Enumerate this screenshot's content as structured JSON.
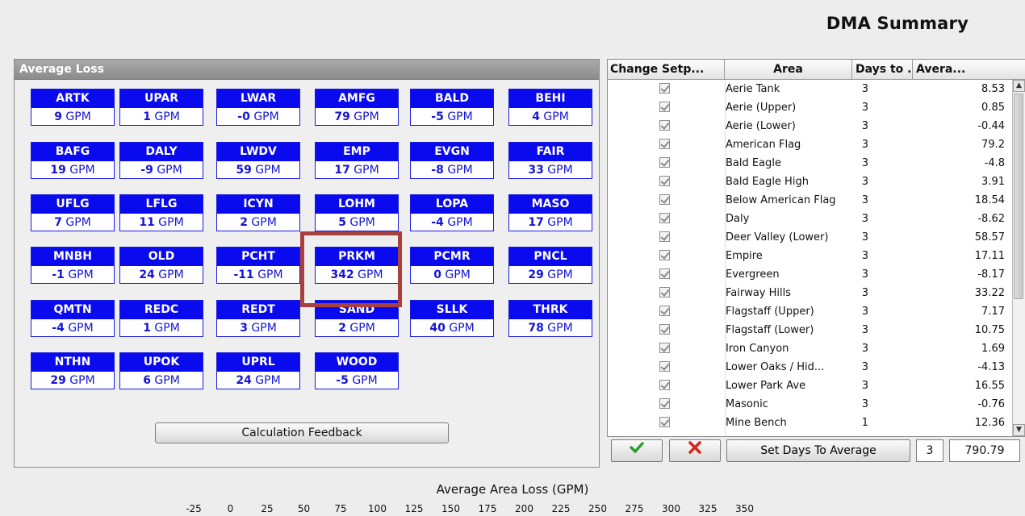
{
  "page": {
    "title": "DMA Summary"
  },
  "loss_panel": {
    "header": "Average Loss",
    "calc_button": "Calculation Feedback",
    "tiles": [
      {
        "code": "ARTK",
        "value": "9",
        "unit": "GPM"
      },
      {
        "code": "UPAR",
        "value": "1",
        "unit": "GPM"
      },
      {
        "code": "LWAR",
        "value": "-0",
        "unit": "GPM"
      },
      {
        "code": "AMFG",
        "value": "79",
        "unit": "GPM"
      },
      {
        "code": "BALD",
        "value": "-5",
        "unit": "GPM"
      },
      {
        "code": "BEHI",
        "value": "4",
        "unit": "GPM"
      },
      {
        "code": "BAFG",
        "value": "19",
        "unit": "GPM"
      },
      {
        "code": "DALY",
        "value": "-9",
        "unit": "GPM"
      },
      {
        "code": "LWDV",
        "value": "59",
        "unit": "GPM"
      },
      {
        "code": "EMP",
        "value": "17",
        "unit": "GPM"
      },
      {
        "code": "EVGN",
        "value": "-8",
        "unit": "GPM"
      },
      {
        "code": "FAIR",
        "value": "33",
        "unit": "GPM"
      },
      {
        "code": "UFLG",
        "value": "7",
        "unit": "GPM"
      },
      {
        "code": "LFLG",
        "value": "11",
        "unit": "GPM"
      },
      {
        "code": "ICYN",
        "value": "2",
        "unit": "GPM"
      },
      {
        "code": "LOHM",
        "value": "5",
        "unit": "GPM"
      },
      {
        "code": "LOPA",
        "value": "-4",
        "unit": "GPM"
      },
      {
        "code": "MASO",
        "value": "17",
        "unit": "GPM"
      },
      {
        "code": "MNBH",
        "value": "-1",
        "unit": "GPM"
      },
      {
        "code": "OLD",
        "value": "24",
        "unit": "GPM"
      },
      {
        "code": "PCHT",
        "value": "-11",
        "unit": "GPM"
      },
      {
        "code": "PRKM",
        "value": "342",
        "unit": "GPM"
      },
      {
        "code": "PCMR",
        "value": "0",
        "unit": "GPM"
      },
      {
        "code": "PNCL",
        "value": "29",
        "unit": "GPM"
      },
      {
        "code": "QMTN",
        "value": "-4",
        "unit": "GPM"
      },
      {
        "code": "REDC",
        "value": "1",
        "unit": "GPM"
      },
      {
        "code": "REDT",
        "value": "3",
        "unit": "GPM"
      },
      {
        "code": "SAND",
        "value": "2",
        "unit": "GPM"
      },
      {
        "code": "SLLK",
        "value": "40",
        "unit": "GPM"
      },
      {
        "code": "THRK",
        "value": "78",
        "unit": "GPM"
      },
      {
        "code": "NTHN",
        "value": "29",
        "unit": "GPM"
      },
      {
        "code": "UPOK",
        "value": "6",
        "unit": "GPM"
      },
      {
        "code": "UPRL",
        "value": "24",
        "unit": "GPM"
      },
      {
        "code": "WOOD",
        "value": "-5",
        "unit": "GPM"
      }
    ]
  },
  "grid": {
    "columns": [
      "Change Setp...",
      "Area",
      "Days to ...",
      "Avera..."
    ],
    "rows": [
      {
        "checked": true,
        "area": "Aerie Tank",
        "days": "3",
        "avg": "8.53"
      },
      {
        "checked": true,
        "area": "Aerie (Upper)",
        "days": "3",
        "avg": "0.85"
      },
      {
        "checked": true,
        "area": "Aerie (Lower)",
        "days": "3",
        "avg": "-0.44"
      },
      {
        "checked": true,
        "area": "American Flag",
        "days": "3",
        "avg": "79.2"
      },
      {
        "checked": true,
        "area": "Bald Eagle",
        "days": "3",
        "avg": "-4.8"
      },
      {
        "checked": true,
        "area": "Bald Eagle High",
        "days": "3",
        "avg": "3.91"
      },
      {
        "checked": true,
        "area": "Below American Flag",
        "days": "3",
        "avg": "18.54"
      },
      {
        "checked": true,
        "area": "Daly",
        "days": "3",
        "avg": "-8.62"
      },
      {
        "checked": true,
        "area": "Deer Valley (Lower)",
        "days": "3",
        "avg": "58.57"
      },
      {
        "checked": true,
        "area": "Empire",
        "days": "3",
        "avg": "17.11"
      },
      {
        "checked": true,
        "area": "Evergreen",
        "days": "3",
        "avg": "-8.17"
      },
      {
        "checked": true,
        "area": "Fairway Hills",
        "days": "3",
        "avg": "33.22"
      },
      {
        "checked": true,
        "area": "Flagstaff (Upper)",
        "days": "3",
        "avg": "7.17"
      },
      {
        "checked": true,
        "area": "Flagstaff (Lower)",
        "days": "3",
        "avg": "10.75"
      },
      {
        "checked": true,
        "area": "Iron Canyon",
        "days": "3",
        "avg": "1.69"
      },
      {
        "checked": true,
        "area": "Lower Oaks / Hid...",
        "days": "3",
        "avg": "-4.13"
      },
      {
        "checked": true,
        "area": "Lower Park Ave",
        "days": "3",
        "avg": "16.55"
      },
      {
        "checked": true,
        "area": "Masonic",
        "days": "3",
        "avg": "-0.76"
      },
      {
        "checked": true,
        "area": "Mine Bench",
        "days": "1",
        "avg": "12.36"
      }
    ]
  },
  "toolbar": {
    "accept_icon": "checkmark-icon",
    "reject_icon": "x-icon",
    "set_days_label": "Set Days To Average",
    "days_value": "3",
    "total_value": "790.79"
  },
  "chart_data": {
    "type": "bar",
    "title": "Average Area Loss (GPM)",
    "x_ticks": [
      "-25",
      "0",
      "25",
      "50",
      "75",
      "100",
      "125",
      "150",
      "175",
      "200",
      "225",
      "250",
      "275",
      "300",
      "325",
      "350"
    ],
    "xlim": [
      -25,
      350
    ]
  }
}
